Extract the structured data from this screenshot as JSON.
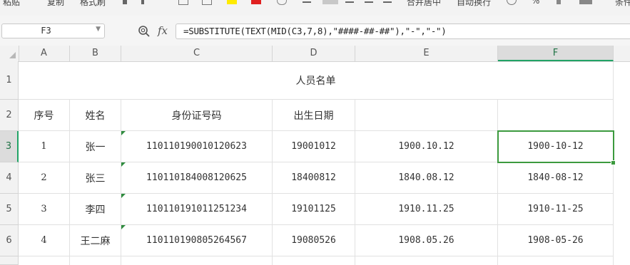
{
  "ribbon": {
    "items": [
      "粘贴",
      "复制",
      "格式刷",
      "合并居中",
      "自动换行",
      "条件"
    ]
  },
  "formula_bar": {
    "name_box": "F3",
    "fx_label": "fx",
    "formula": "=SUBSTITUTE(TEXT(MID(C3,7,8),\"####-##-##\"),\"-\",\"-\")"
  },
  "columns": [
    "A",
    "B",
    "C",
    "D",
    "E",
    "F"
  ],
  "rows": [
    "1",
    "2",
    "3",
    "4",
    "5",
    "6"
  ],
  "sheet": {
    "title": "人员名单",
    "headers": [
      "序号",
      "姓名",
      "身份证号码",
      "出生日期",
      "",
      ""
    ],
    "data": [
      [
        "1",
        "张一",
        "110110190010120623",
        "19001012",
        "1900.10.12",
        "1900-10-12"
      ],
      [
        "2",
        "张三",
        "110110184008120625",
        "18400812",
        "1840.08.12",
        "1840-08-12"
      ],
      [
        "3",
        "李四",
        "110110191011251234",
        "19101125",
        "1910.11.25",
        "1910-11-25"
      ],
      [
        "4",
        "王二麻",
        "110110190805264567",
        "19080526",
        "1908.05.26",
        "1908-05-26"
      ]
    ]
  },
  "colors": {
    "accent": "#21a366",
    "selection": "#3c9a3e",
    "error_triangle": "#2e8b3e"
  },
  "icons": [
    "zoom-icon",
    "fx-icon",
    "dropdown-arrow-icon",
    "select-all-icon"
  ]
}
